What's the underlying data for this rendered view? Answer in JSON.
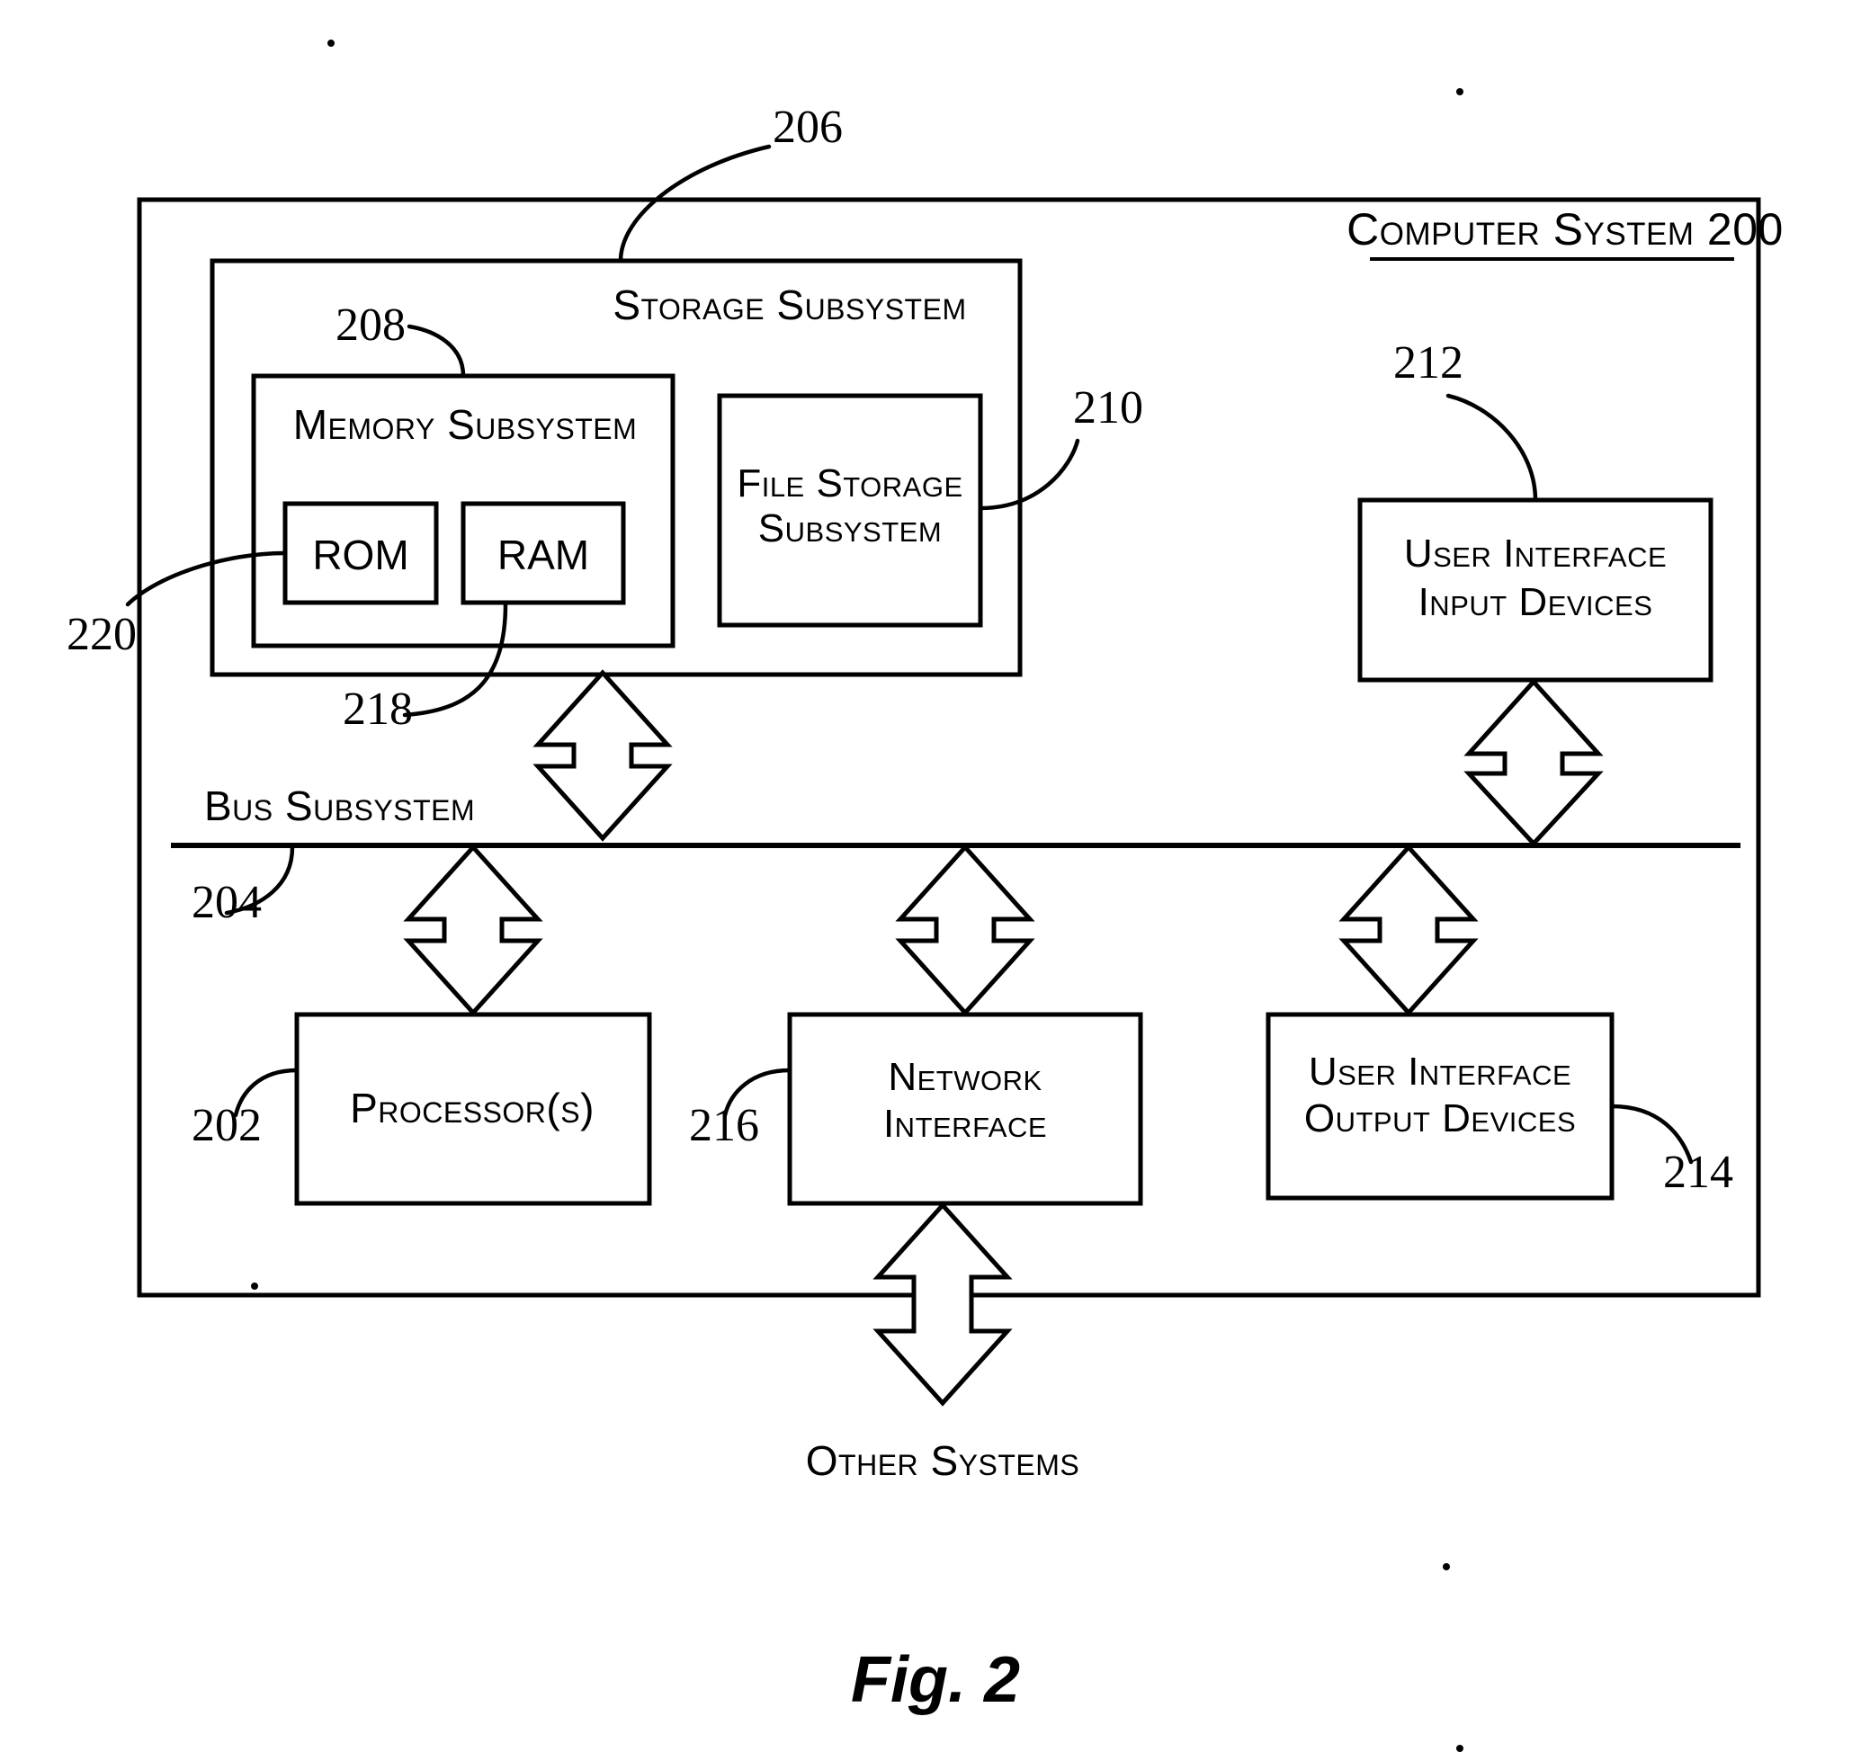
{
  "figure": {
    "caption": "Fig. 2",
    "system_label": "Computer System",
    "system_ref": "200"
  },
  "blocks": {
    "storage_subsystem": {
      "label": "Storage Subsystem",
      "ref": "206"
    },
    "memory_subsystem": {
      "label": "Memory Subsystem",
      "ref": "208"
    },
    "rom": {
      "label": "ROM",
      "ref": "220"
    },
    "ram": {
      "label": "RAM",
      "ref": "218"
    },
    "file_storage_subsystem": {
      "label_line1": "File Storage",
      "label_line2": "Subsystem",
      "ref": "210"
    },
    "ui_input_devices": {
      "label_line1": "User Interface",
      "label_line2": "Input Devices",
      "ref": "212"
    },
    "ui_output_devices": {
      "label_line1": "User Interface",
      "label_line2": "Output Devices",
      "ref": "214"
    },
    "bus_subsystem": {
      "label": "Bus Subsystem",
      "ref": "204"
    },
    "processors": {
      "label": "Processor(s)",
      "ref": "202"
    },
    "network_interface": {
      "label_line1": "Network",
      "label_line2": "Interface",
      "ref": "216"
    },
    "other_systems": {
      "label": "Other Systems"
    }
  },
  "colors": {
    "ink": "#000000",
    "paper": "#ffffff"
  }
}
